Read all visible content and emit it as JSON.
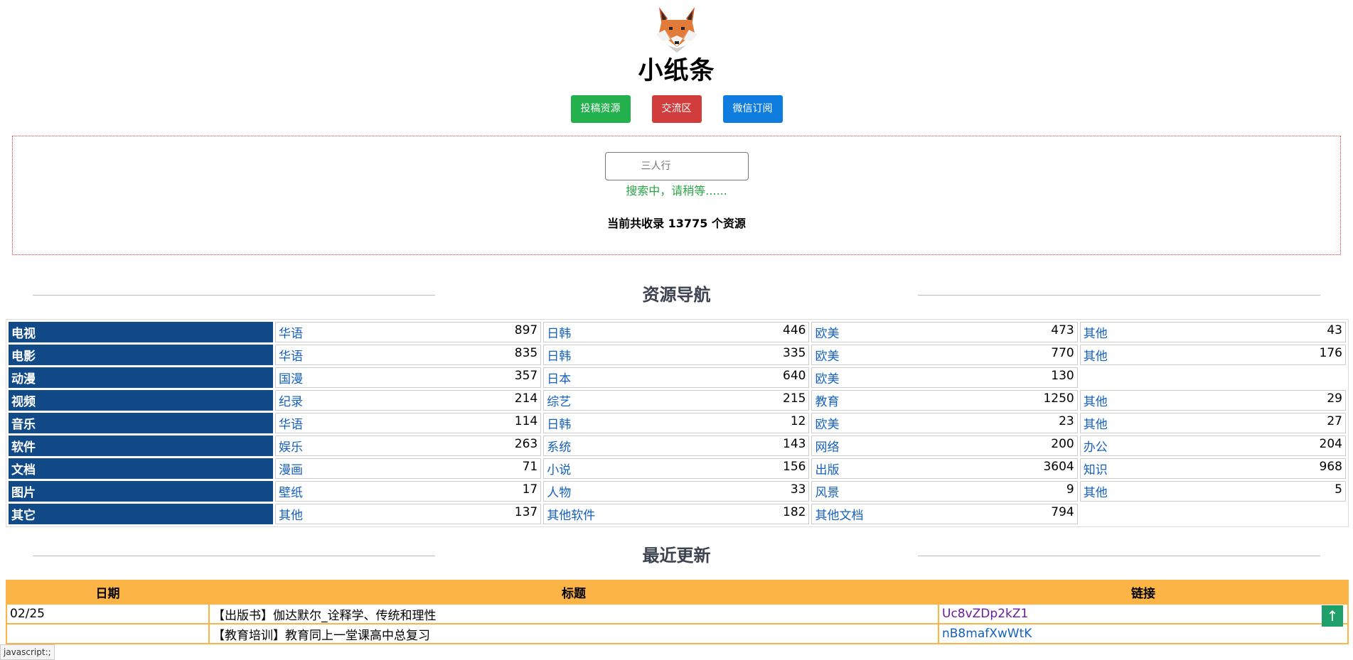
{
  "site": {
    "title": "小纸条"
  },
  "buttons": [
    {
      "label": "投稿资源",
      "color": "#22b14c"
    },
    {
      "label": "交流区",
      "color": "#d13d3d"
    },
    {
      "label": "微信订阅",
      "color": "#0f7de0"
    }
  ],
  "search": {
    "placeholder": "三人行",
    "status": "搜索中，请稍等......",
    "total": "当前共收录 13775 个资源"
  },
  "nav": {
    "heading": "资源导航",
    "rows": [
      {
        "cat": "电视",
        "items": [
          [
            "华语",
            "897"
          ],
          [
            "日韩",
            "446"
          ],
          [
            "欧美",
            "473"
          ],
          [
            "其他",
            "43"
          ]
        ]
      },
      {
        "cat": "电影",
        "items": [
          [
            "华语",
            "835"
          ],
          [
            "日韩",
            "335"
          ],
          [
            "欧美",
            "770"
          ],
          [
            "其他",
            "176"
          ]
        ]
      },
      {
        "cat": "动漫",
        "items": [
          [
            "国漫",
            "357"
          ],
          [
            "日本",
            "640"
          ],
          [
            "欧美",
            "130"
          ]
        ]
      },
      {
        "cat": "视频",
        "items": [
          [
            "纪录",
            "214"
          ],
          [
            "综艺",
            "215"
          ],
          [
            "教育",
            "1250"
          ],
          [
            "其他",
            "29"
          ]
        ]
      },
      {
        "cat": "音乐",
        "items": [
          [
            "华语",
            "114"
          ],
          [
            "日韩",
            "12"
          ],
          [
            "欧美",
            "23"
          ],
          [
            "其他",
            "27"
          ]
        ]
      },
      {
        "cat": "软件",
        "items": [
          [
            "娱乐",
            "263"
          ],
          [
            "系统",
            "143"
          ],
          [
            "网络",
            "200"
          ],
          [
            "办公",
            "204"
          ]
        ]
      },
      {
        "cat": "文档",
        "items": [
          [
            "漫画",
            "71"
          ],
          [
            "小说",
            "156"
          ],
          [
            "出版",
            "3604"
          ],
          [
            "知识",
            "968"
          ]
        ]
      },
      {
        "cat": "图片",
        "items": [
          [
            "壁纸",
            "17"
          ],
          [
            "人物",
            "33"
          ],
          [
            "风景",
            "9"
          ],
          [
            "其他",
            "5"
          ]
        ]
      },
      {
        "cat": "其它",
        "items": [
          [
            "其他",
            "137"
          ],
          [
            "其他软件",
            "182"
          ],
          [
            "其他文档",
            "794"
          ]
        ]
      }
    ]
  },
  "updates": {
    "heading": "最近更新",
    "columns": [
      "日期",
      "标题",
      "链接"
    ],
    "rows": [
      {
        "date": "02/25",
        "title": "【出版书】伽达默尔_诠释学、传统和理性",
        "link": "Uc8vZDp2kZ1",
        "visited": true
      },
      {
        "date": "",
        "title": "【教育培训】教育同上一堂课高中总复习",
        "link": "nB8mafXwWtK",
        "visited": false
      }
    ]
  },
  "status_bar": "javascript:;",
  "to_top_icon": "arrow-up-icon"
}
